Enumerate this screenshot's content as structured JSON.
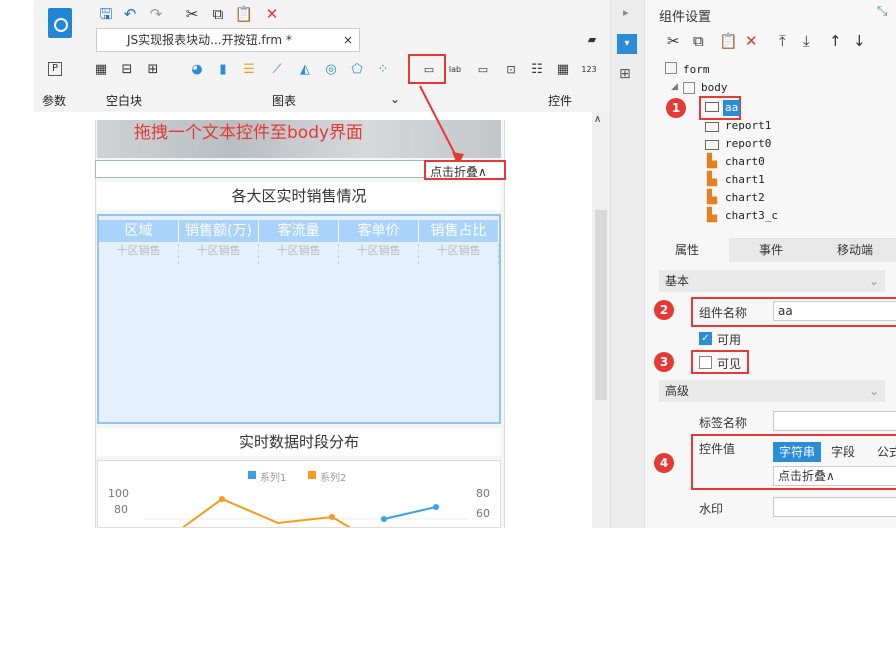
{
  "toolbar": {
    "tab_title": "JS实现报表块动...开按钮.frm *",
    "close": "×"
  },
  "ribbon": {
    "group_params": "参数",
    "group_blank": "空白块",
    "group_chart": "图表",
    "group_controls": "控件",
    "params_icon": "P"
  },
  "annotation": {
    "drag_text": "拖拽一个文本控件至body界面",
    "accent": "#e53935"
  },
  "canvas": {
    "collapse_text": "点击折叠∧",
    "title1": "各大区实时销售情况",
    "title2": "实时数据时段分布",
    "headers": [
      "区域",
      "销售额(万)",
      "客流量",
      "客单价",
      "销售占比"
    ],
    "row": [
      "十区销售",
      "十区销售",
      "十区销售",
      "十区销售",
      "十区销售"
    ],
    "legend": [
      "系列1",
      "系列2"
    ],
    "yleft": [
      "100",
      "80"
    ],
    "yright": [
      "80",
      "60"
    ]
  },
  "panel": {
    "title": "组件设置",
    "tree": [
      "form",
      "body",
      "aa",
      "report1",
      "report0",
      "chart0",
      "chart1",
      "chart2",
      "chart3_c"
    ],
    "tabs": [
      "属性",
      "事件",
      "移动端"
    ],
    "sec_basic": "基本",
    "name_label": "组件名称",
    "name_value": "aa",
    "enabled_label": "可用",
    "visible_label": "可见",
    "sec_adv": "高级",
    "tag_label": "标签名称",
    "value_label": "控件值",
    "value_types": [
      "字符串",
      "字段",
      "公式"
    ],
    "value_text": "点击折叠∧",
    "watermark_label": "水印"
  },
  "badges": [
    "1",
    "2",
    "3",
    "4"
  ]
}
